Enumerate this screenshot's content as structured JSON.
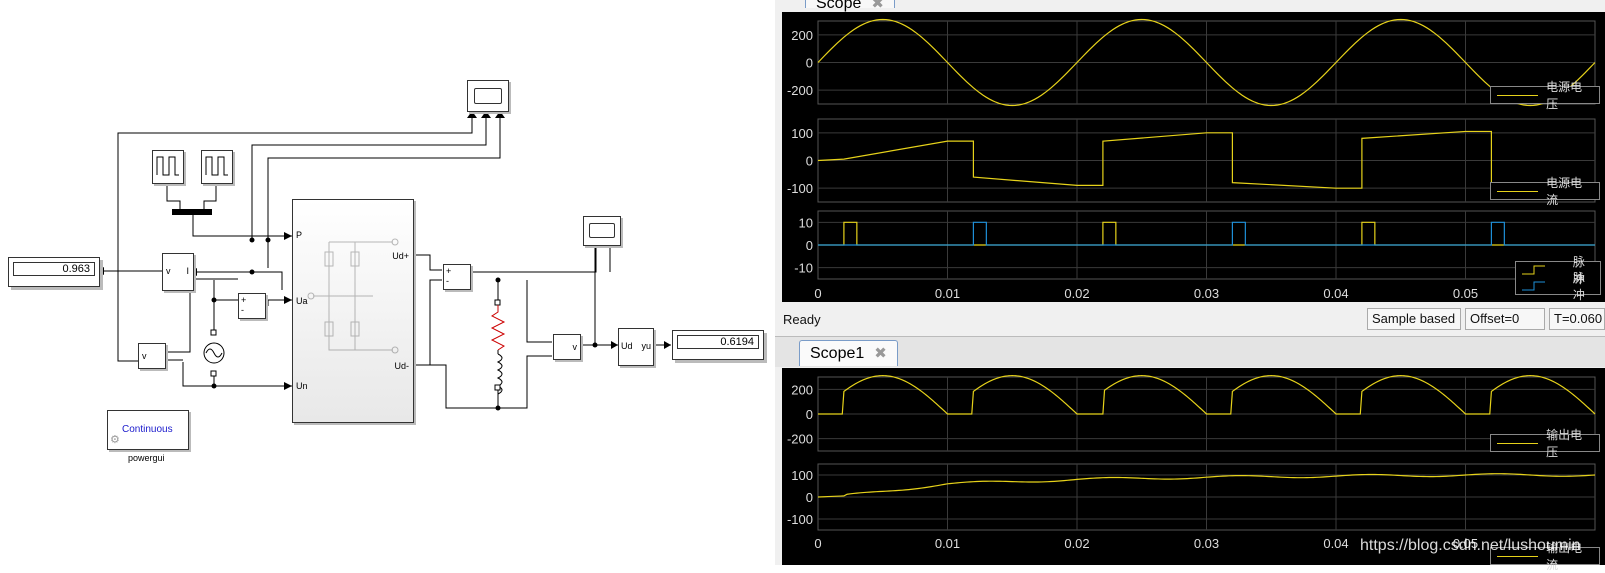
{
  "model": {
    "display_left_value": "0.963",
    "display_right_value": "0.6194",
    "powergui_mode": "Continuous",
    "powergui_label": "powergui",
    "port_labels": {
      "p": "P",
      "ua": "Ua",
      "un": "Un",
      "ud_plus": "Ud+",
      "ud_minus": "Ud-"
    },
    "vi_label": "v",
    "vi_label2": "I",
    "ud_label": "Ud",
    "yu_label": "yu"
  },
  "scope_top": {
    "tab_label": "Scope",
    "status": "Ready",
    "sample_mode": "Sample based",
    "offset": "Offset=0",
    "time": "T=0.060",
    "x_ticks": [
      "0",
      "0.01",
      "0.02",
      "0.03",
      "0.04",
      "0.05"
    ],
    "plots": [
      {
        "y_ticks": [
          "200",
          "0",
          "-200"
        ],
        "legend": [
          "电源电压"
        ]
      },
      {
        "y_ticks": [
          "100",
          "0",
          "-100"
        ],
        "legend": [
          "电源电流"
        ]
      },
      {
        "y_ticks": [
          "10",
          "0",
          "-10"
        ],
        "legend": [
          "脉冲",
          "脉冲"
        ]
      }
    ]
  },
  "scope_bottom": {
    "tab_label": "Scope1",
    "x_ticks": [
      "0",
      "0.01",
      "0.02",
      "0.03",
      "0.04",
      "0.05"
    ],
    "plots": [
      {
        "y_ticks": [
          "200",
          "0",
          "-200"
        ],
        "legend": [
          "输出电压"
        ]
      },
      {
        "y_ticks": [
          "100",
          "0",
          "-100"
        ],
        "legend": [
          "输出电流"
        ]
      }
    ]
  },
  "colors": {
    "trace_yellow": "#e6d21a",
    "trace_blue": "#1e8fd8",
    "plot_bg": "#000000",
    "grid": "#3a3a3a"
  },
  "chart_data": [
    {
      "type": "line",
      "series": [
        {
          "name": "电源电压",
          "x": [
            0,
            0.005,
            0.01,
            0.015,
            0.02,
            0.025,
            0.03,
            0.035,
            0.04,
            0.045,
            0.05,
            0.055,
            0.06
          ],
          "y": [
            0,
            311,
            0,
            -311,
            0,
            311,
            0,
            -311,
            0,
            311,
            0,
            -311,
            0
          ]
        }
      ],
      "xlim": [
        0,
        0.06
      ],
      "ylim": [
        -300,
        300
      ]
    },
    {
      "type": "line",
      "series": [
        {
          "name": "电源电流",
          "x": [
            0,
            0.002,
            0.01,
            0.012,
            0.02,
            0.022,
            0.03,
            0.032,
            0.04,
            0.042,
            0.05,
            0.052,
            0.06
          ],
          "y": [
            0,
            5,
            70,
            -60,
            -90,
            70,
            100,
            -80,
            -100,
            80,
            105,
            -85,
            -105
          ]
        }
      ],
      "xlim": [
        0,
        0.06
      ],
      "ylim": [
        -150,
        150
      ]
    },
    {
      "type": "line",
      "series": [
        {
          "name": "脉冲",
          "pulse_starts": [
            0.002,
            0.022,
            0.042
          ],
          "width": 0.001,
          "height": 10
        },
        {
          "name": "脉冲",
          "pulse_starts": [
            0.012,
            0.032,
            0.052
          ],
          "width": 0.001,
          "height": 10
        }
      ],
      "xlim": [
        0,
        0.06
      ],
      "ylim": [
        -15,
        15
      ]
    },
    {
      "type": "line",
      "series": [
        {
          "name": "输出电压",
          "alpha": 0.002,
          "amplitude": 311
        }
      ],
      "xlim": [
        0,
        0.06
      ],
      "ylim": [
        -300,
        300
      ]
    },
    {
      "type": "line",
      "series": [
        {
          "name": "输出电流",
          "x": [
            0,
            0.002,
            0.01,
            0.02,
            0.03,
            0.04,
            0.05,
            0.06
          ],
          "y": [
            0,
            5,
            60,
            80,
            90,
            95,
            100,
            100
          ]
        }
      ],
      "xlim": [
        0,
        0.06
      ],
      "ylim": [
        -150,
        150
      ]
    }
  ]
}
